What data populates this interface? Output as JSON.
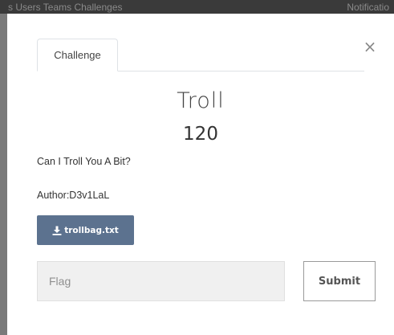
{
  "background_nav": {
    "left_text": "s  Users  Teams  Challenges",
    "right_text": "Notificatio"
  },
  "modal": {
    "close_glyph": "×",
    "tabs": [
      {
        "label": "Challenge"
      }
    ],
    "challenge": {
      "name": "Troll",
      "value": "120",
      "description": "Can I Troll You A Bit?",
      "author": "Author:D3v1LaL"
    },
    "file": {
      "label": "trollbag.txt",
      "icon": "download-icon"
    },
    "form": {
      "flag_placeholder": "Flag",
      "flag_value": "",
      "submit_label": "Submit"
    }
  },
  "colors": {
    "file_button_bg": "#5c728f",
    "input_bg": "#f0f0f0",
    "text": "#333333"
  }
}
